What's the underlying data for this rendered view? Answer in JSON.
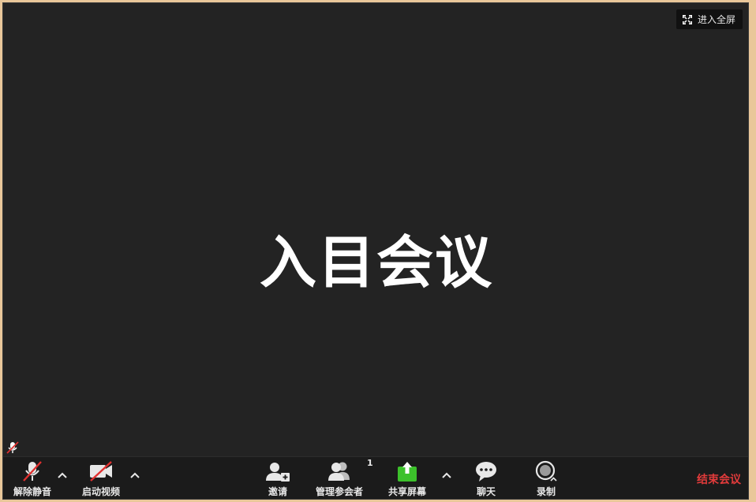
{
  "header": {
    "fullscreen_label": "进入全屏"
  },
  "stage": {
    "participant_name": "入目会议"
  },
  "toolbar": {
    "unmute_label": "解除静音",
    "start_video_label": "启动视频",
    "invite_label": "邀请",
    "manage_participants_label": "管理参会者",
    "participants_count": "1",
    "share_screen_label": "共享屏幕",
    "chat_label": "聊天",
    "record_label": "录制",
    "end_meeting_label": "结束会议"
  },
  "colors": {
    "share_green": "#3cc12b",
    "end_red": "#e23b3b",
    "muted_red": "#e0302f",
    "stage_bg": "#232323",
    "toolbar_bg": "#1b1b1b"
  },
  "icons": [
    "expand-icon",
    "mic-muted-icon",
    "video-off-icon",
    "add-user-icon",
    "participants-icon",
    "share-screen-icon",
    "chat-bubble-icon",
    "record-icon",
    "caret-up-icon"
  ]
}
